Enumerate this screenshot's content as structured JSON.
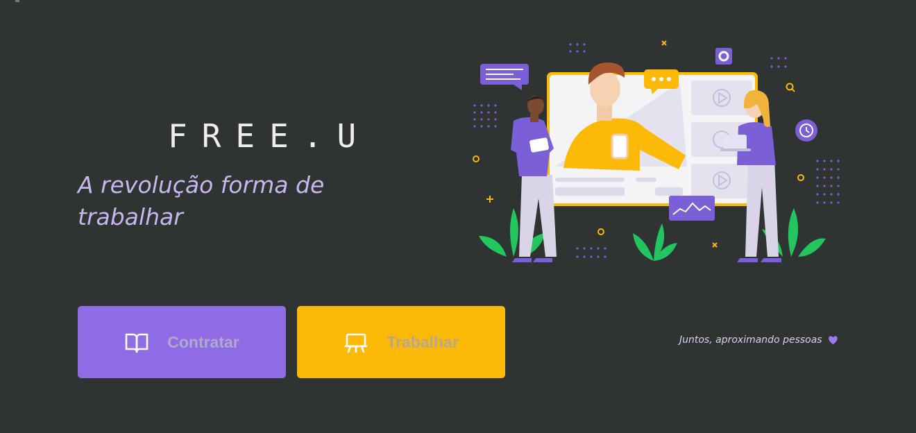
{
  "brand": {
    "logo_text": "FREE.U"
  },
  "hero": {
    "tagline": "A revolução forma de trabalhar"
  },
  "actions": {
    "hire_label": "Contratar",
    "work_label": "Trabalhar"
  },
  "footer": {
    "note": "Juntos, aproximando pessoas"
  },
  "icons": {
    "hire": "book-open-icon",
    "work": "presentation-board-icon",
    "note": "heart-icon"
  },
  "colors": {
    "background": "#2f3331",
    "primary_purple": "#8f6ce6",
    "primary_yellow": "#fdb908",
    "tagline": "#c4b9ef"
  }
}
